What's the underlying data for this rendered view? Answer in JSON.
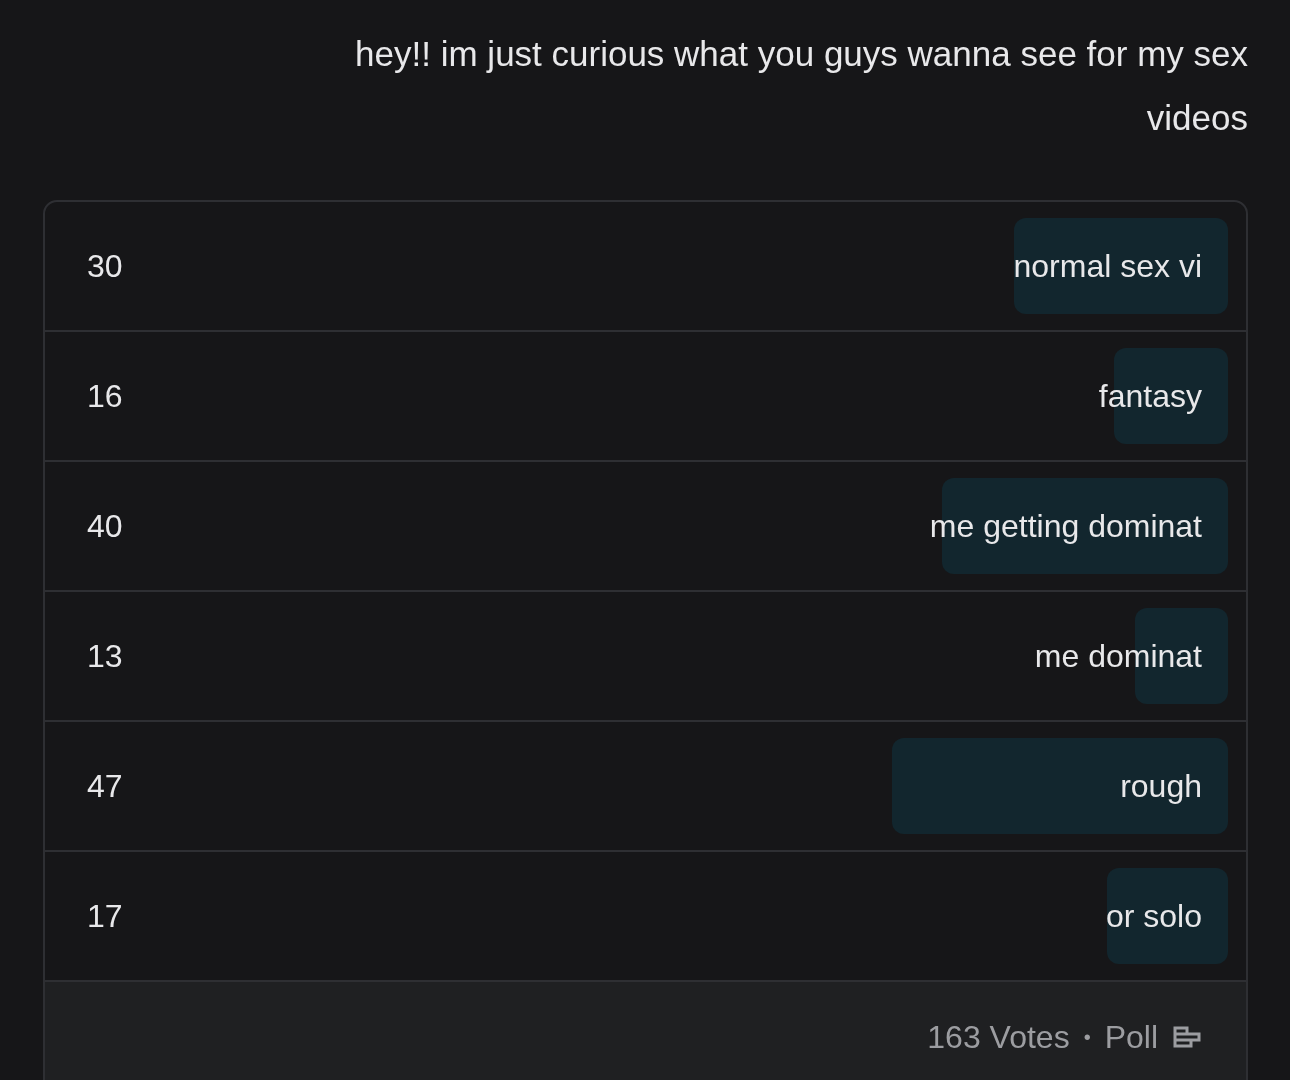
{
  "post": {
    "text": "hey!! im just curious what you guys wanna see for my sex videos"
  },
  "poll": {
    "options": [
      {
        "label": "normal sex vi",
        "count": "30"
      },
      {
        "label": "fantasy",
        "count": "16"
      },
      {
        "label": "me getting dominat",
        "count": "40"
      },
      {
        "label": "me dominat",
        "count": "13"
      },
      {
        "label": "rough",
        "count": "47"
      },
      {
        "label": "or solo",
        "count": "17"
      }
    ],
    "footer": {
      "kind": "Poll",
      "separator": "•",
      "votes": "163 Votes"
    }
  }
}
